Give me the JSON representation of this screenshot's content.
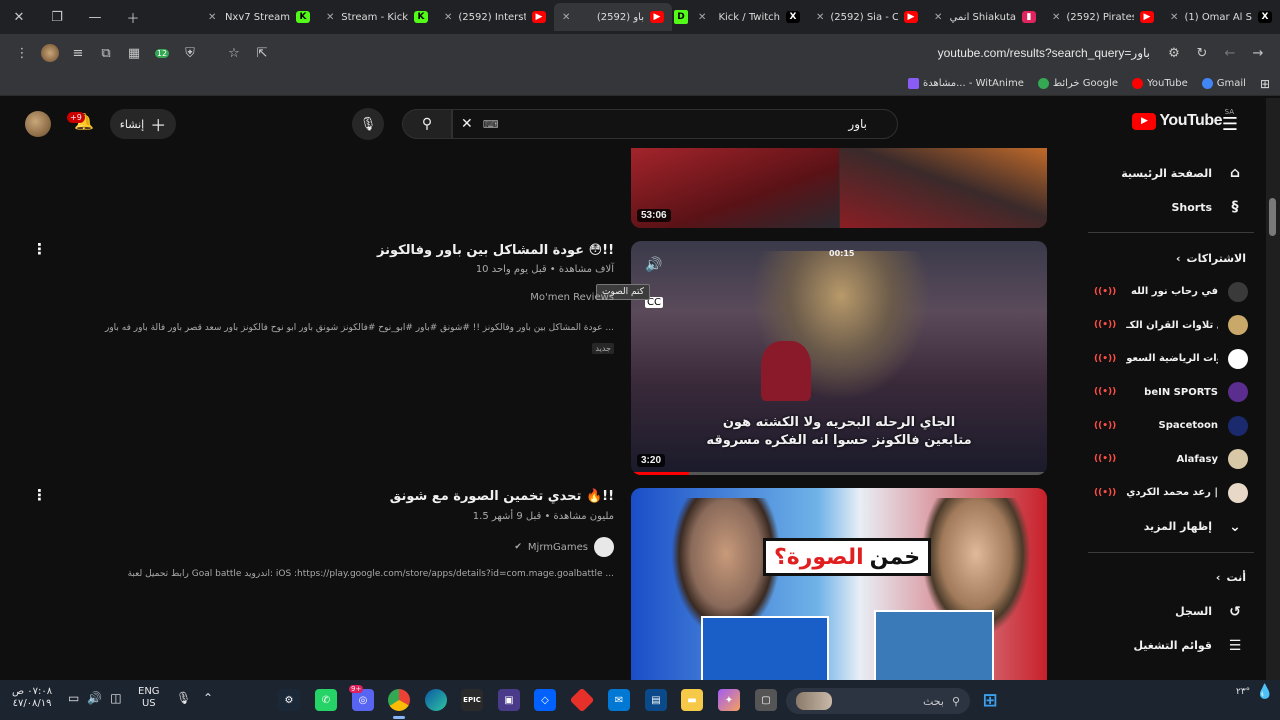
{
  "browser": {
    "tabs": [
      {
        "title": "(1) Omar Al S",
        "favicon": "x-icon",
        "favicon_color": "#000000",
        "favicon_text": "X",
        "active": false
      },
      {
        "title": "(2592) Pirates",
        "favicon": "youtube-icon",
        "favicon_color": "#ff0000",
        "favicon_text": "▶",
        "active": false
      },
      {
        "title": "انمي Shiakuta",
        "favicon": "bookmark-icon",
        "favicon_color": "#e0245e",
        "favicon_text": "▮",
        "active": false
      },
      {
        "title": "(2592) Sia - C",
        "favicon": "youtube-icon",
        "favicon_color": "#ff0000",
        "favicon_text": "▶",
        "active": false
      },
      {
        "title": "Kick / Twitch",
        "favicon": "x-icon",
        "favicon_color": "#000000",
        "favicon_text": "X",
        "active": false
      },
      {
        "title": "(2592) باو",
        "favicon": "youtube-icon",
        "favicon_color": "#ff0000",
        "favicon_text": "▶",
        "active": true
      },
      {
        "title": "(2592) Intersta",
        "favicon": "youtube-icon",
        "favicon_color": "#ff0000",
        "favicon_text": "▶",
        "active": false
      },
      {
        "title": "Stream - Kick",
        "favicon": "kick-icon",
        "favicon_color": "#53fc18",
        "favicon_text": "K",
        "active": false
      },
      {
        "title": "Nxv7 Stream",
        "favicon": "kick-icon",
        "favicon_color": "#53fc18",
        "favicon_text": "K",
        "active": false
      }
    ],
    "extra_tab_icon": "D",
    "url": "youtube.com/results?search_query=باور",
    "bookmarks": [
      {
        "label": "Gmail",
        "color": "#4285f4"
      },
      {
        "label": "YouTube",
        "color": "#ff0000"
      },
      {
        "label": "خرائط Google",
        "color": "#34a853"
      },
      {
        "label": "مشاهدة... - WitAnime",
        "color": "#8a5cf6"
      }
    ]
  },
  "youtube": {
    "logo_text": "YouTube",
    "country_code": "SA",
    "search_value": "باور",
    "create_label": "إنشاء",
    "notification_count": "+9",
    "sidebar": {
      "home_label": "الصفحة الرئيسية",
      "shorts_label": "Shorts",
      "subscriptions_heading": "الاشتراكات",
      "subscriptions": [
        {
          "name": "في رحاب نور الله",
          "color": "#3a3a3a"
        },
        {
          "name": "أجمل تلاوات القرآن الكـ...",
          "color": "#c9a86a"
        },
        {
          "name": "القنوات الرياضية السعو...",
          "color": "#ffffff"
        },
        {
          "name": "beIN SPORTS",
          "color": "#5b2d8e"
        },
        {
          "name": "Spacetoon",
          "color": "#1a2a6c"
        },
        {
          "name": "Alafasy",
          "color": "#d8c8a8"
        },
        {
          "name": "رعد محمد الكردي | di...",
          "color": "#e8d8c8"
        }
      ],
      "show_more_label": "إظهار المزيد",
      "you_heading": "أنت",
      "history_label": "السجل",
      "playlists_label": "قوائم التشغيل"
    },
    "videos": [
      {
        "duration": "53:06"
      },
      {
        "title": "عودة المشاكل بين باور وفالكونز 😳!!",
        "meta": "10 آلاف مشاهدة • قبل يوم واحد",
        "channel": "Mo'men Reviews",
        "description": "عودة المشاكل بين باور وفالكونز !! #شونق #باور #ابو_نوح #فالكونز شونق باور ابو نوح فالكونز باور سعد قصر باور فالة باور فه باور ...",
        "badge": "جديد",
        "duration": "3:20",
        "overlay_text_1": "الجاي الرحله البحريه ولا الكشته هون",
        "overlay_text_2": "متابعين فالكونز حسوا انه الفكره مسروقه",
        "tooltip": "كتم الصوت",
        "timer": "00:15"
      },
      {
        "title": "تحدي تخمين الصورة مع شونق 🔥!!",
        "meta": "1.5 مليون مشاهدة • قبل 9 أشهر",
        "channel": "MjrmGames",
        "description": "رابط تحميل لعبة Goal battle اندرويد: iOS :https://play.google.com/store/apps/details?id=com.mage.goalbattle ...",
        "thumb_text_1": "خمن",
        "thumb_text_2": "الصورة؟"
      }
    ]
  },
  "taskbar": {
    "search_placeholder": "بحث",
    "lang_1": "ENG",
    "lang_2": "US",
    "time": "٠٧:٠٨ ص",
    "date": "٤٧/٠٨/١٩",
    "discord_badge": "9+",
    "temp": "٢٣°"
  }
}
